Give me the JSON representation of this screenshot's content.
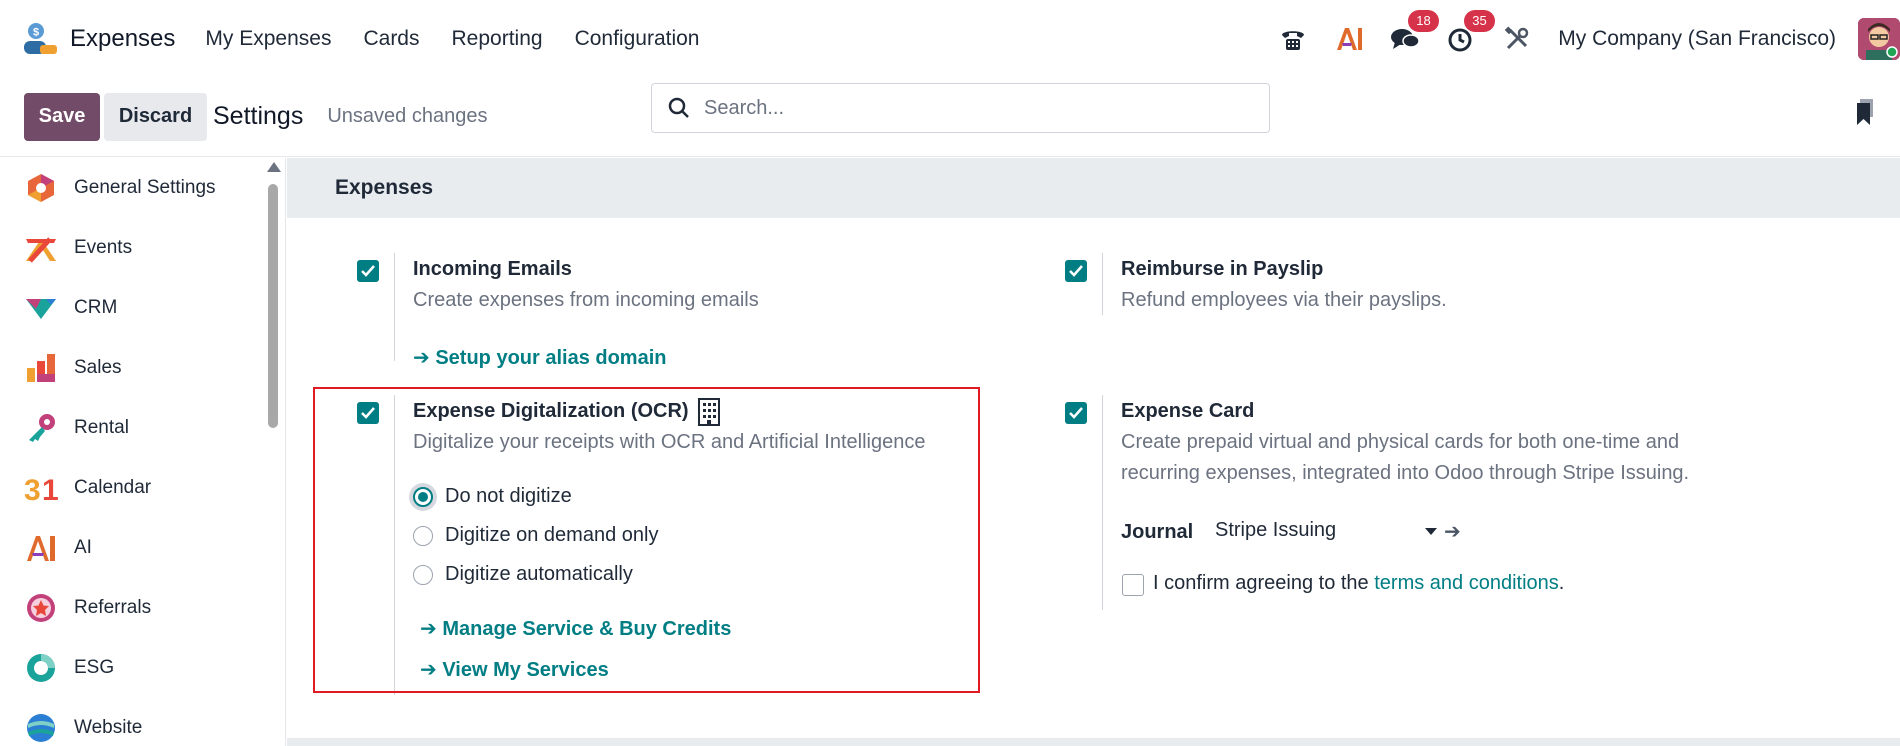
{
  "navbar": {
    "app_name": "Expenses",
    "menu": [
      "My Expenses",
      "Cards",
      "Reporting",
      "Configuration"
    ],
    "messages_badge": "18",
    "activities_badge": "35",
    "company": "My Company (San Francisco)"
  },
  "control": {
    "save_label": "Save",
    "discard_label": "Discard",
    "title": "Settings",
    "status": "Unsaved changes",
    "search_placeholder": "Search..."
  },
  "sidebar": {
    "items": [
      {
        "label": "General Settings",
        "icon": "general-settings-icon"
      },
      {
        "label": "Events",
        "icon": "events-icon"
      },
      {
        "label": "CRM",
        "icon": "crm-icon"
      },
      {
        "label": "Sales",
        "icon": "sales-icon"
      },
      {
        "label": "Rental",
        "icon": "rental-icon"
      },
      {
        "label": "Calendar",
        "icon": "calendar-icon"
      },
      {
        "label": "AI",
        "icon": "ai-icon"
      },
      {
        "label": "Referrals",
        "icon": "referrals-icon"
      },
      {
        "label": "ESG",
        "icon": "esg-icon"
      },
      {
        "label": "Website",
        "icon": "website-icon"
      }
    ]
  },
  "main": {
    "section_title": "Expenses",
    "incoming_emails": {
      "title": "Incoming Emails",
      "desc": "Create expenses from incoming emails",
      "link": "Setup your alias domain",
      "checked": true
    },
    "reimburse": {
      "title": "Reimburse in Payslip",
      "desc": "Refund employees via their payslips.",
      "checked": true
    },
    "ocr": {
      "title": "Expense Digitalization (OCR)",
      "desc": "Digitalize your receipts with OCR and Artificial Intelligence",
      "options": [
        "Do not digitize",
        "Digitize on demand only",
        "Digitize automatically"
      ],
      "selected": "Do not digitize",
      "link_credits": "Manage Service & Buy Credits",
      "link_services": "View My Services",
      "checked": true
    },
    "card": {
      "title": "Expense Card",
      "desc": "Create prepaid virtual and physical cards for both one-time and recurring expenses, integrated into Odoo through Stripe Issuing.",
      "journal_label": "Journal",
      "journal_value": "Stripe Issuing",
      "confirm_text": "I confirm agreeing to the ",
      "terms_link": "terms and conditions",
      "confirm_end": ".",
      "checked": true,
      "confirm_checked": false
    }
  },
  "colors": {
    "brand": "#714b67",
    "accent": "#017e84",
    "badge": "#d6334b",
    "highlight": "#e01b24"
  },
  "arrow_glyph": "➔"
}
